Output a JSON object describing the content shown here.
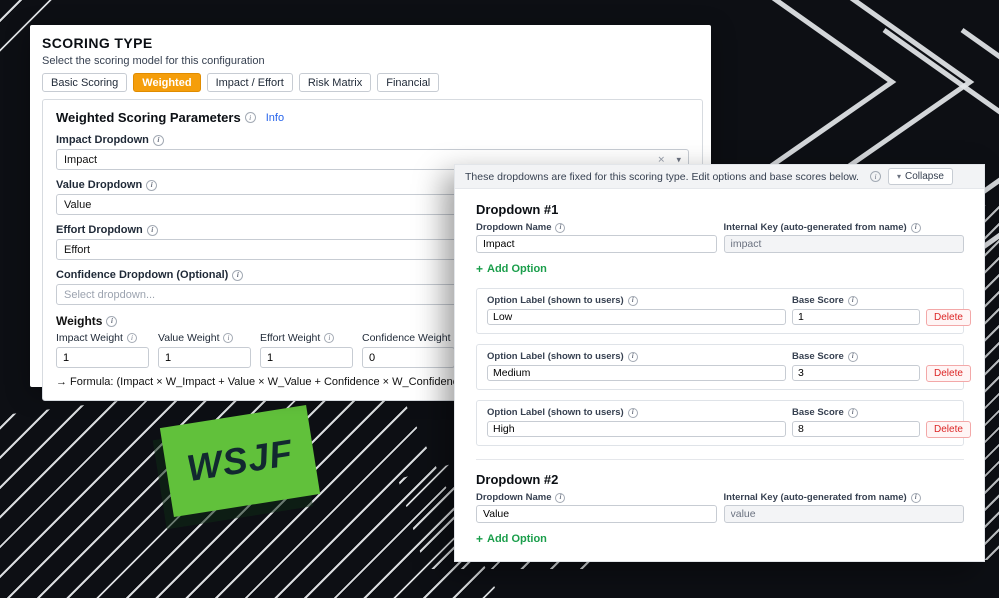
{
  "background": {
    "badge_label": "WSJF"
  },
  "colors": {
    "active_tab": "#f59e0b",
    "add_option_green": "#1a9e4b",
    "delete_red": "#dc2626",
    "badge_green": "#61c13b"
  },
  "panel": {
    "title": "SCORING TYPE",
    "subtitle": "Select the scoring model for this configuration",
    "tabs": [
      {
        "label": "Basic Scoring",
        "active": false
      },
      {
        "label": "Weighted",
        "active": true
      },
      {
        "label": "Impact / Effort",
        "active": false
      },
      {
        "label": "Risk Matrix",
        "active": false
      },
      {
        "label": "Financial",
        "active": false
      }
    ],
    "section": {
      "heading": "Weighted Scoring Parameters",
      "info_link": "Info",
      "impact": {
        "label": "Impact Dropdown",
        "value": "Impact"
      },
      "value": {
        "label": "Value Dropdown",
        "value": "Value"
      },
      "effort": {
        "label": "Effort Dropdown",
        "value": "Effort"
      },
      "confidence": {
        "label": "Confidence Dropdown (Optional)",
        "placeholder": "Select dropdown..."
      },
      "weights": {
        "heading": "Weights",
        "items": [
          {
            "label": "Impact Weight",
            "value": "1"
          },
          {
            "label": "Value Weight",
            "value": "1"
          },
          {
            "label": "Effort Weight",
            "value": "1"
          },
          {
            "label": "Confidence Weight",
            "value": "0"
          }
        ],
        "formula": "→ Formula: (Impact × W_Impact + Value × W_Value + Confidence × W_Confidence) ÷ (Effort × W_Effort)"
      }
    }
  },
  "editor": {
    "notice": "These dropdowns are fixed for this scoring type. Edit options and base scores below.",
    "collapse_label": "Collapse",
    "labels": {
      "name": "Dropdown Name",
      "key": "Internal Key (auto-generated from name)",
      "option_label": "Option Label (shown to users)",
      "base_score": "Base Score",
      "delete": "Delete",
      "add_option": "Add Option"
    },
    "dropdown1": {
      "heading": "Dropdown #1",
      "name_value": "Impact",
      "key_value": "impact",
      "options": [
        {
          "label": "Low",
          "score": "1"
        },
        {
          "label": "Medium",
          "score": "3"
        },
        {
          "label": "High",
          "score": "8"
        }
      ]
    },
    "dropdown2": {
      "heading": "Dropdown #2",
      "name_value": "Value",
      "key_value": "value"
    }
  }
}
